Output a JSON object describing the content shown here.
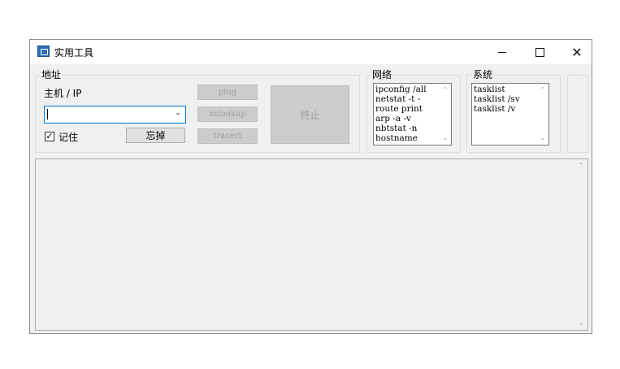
{
  "window": {
    "title": "实用工具",
    "controls": {
      "minimize": "—",
      "maximize": "□",
      "close": "✕"
    }
  },
  "address_group": {
    "title": "地址",
    "host_label": "主机 / IP",
    "host_input_value": "",
    "remember_label": "记住",
    "remember_checked": "✓",
    "forget_button": "忘掉",
    "ping_button": "ping",
    "nslookup_button": "nslookup",
    "tracert_button": "tracert",
    "stop_button": "终止"
  },
  "network_group": {
    "title": "网络",
    "items": [
      "ipconfig /all",
      "netstat -t -",
      "route print",
      "arp -a -v",
      "nbtstat -n",
      "hostname"
    ]
  },
  "system_group": {
    "title": "系统",
    "items": [
      "tasklist",
      "tasklist /sv",
      "tasklist /v"
    ]
  },
  "scroll_glyphs": {
    "up": "⌃",
    "down": "⌄"
  }
}
